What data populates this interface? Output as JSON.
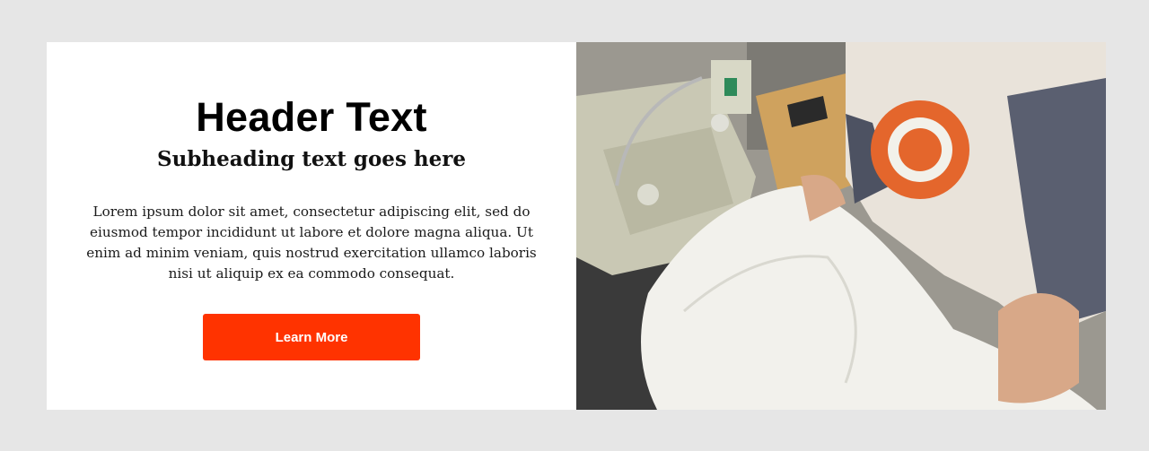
{
  "hero": {
    "title": "Header Text",
    "subtitle": "Subheading text goes here",
    "body": "Lorem ipsum dolor sit amet, consectetur adipiscing elit, sed do eiusmod tempor incididunt ut labore et dolore magna aliqua. Ut enim ad minim veniam, quis nostrud exercitation ullamco laboris nisi ut aliquip ex ea commodo consequat.",
    "button_label": "Learn More"
  },
  "colors": {
    "page_background": "#e6e6e6",
    "card_background": "#ffffff",
    "button_background": "#ff3300",
    "button_text": "#ffffff"
  },
  "photo": {
    "icon": "photo-icon"
  }
}
